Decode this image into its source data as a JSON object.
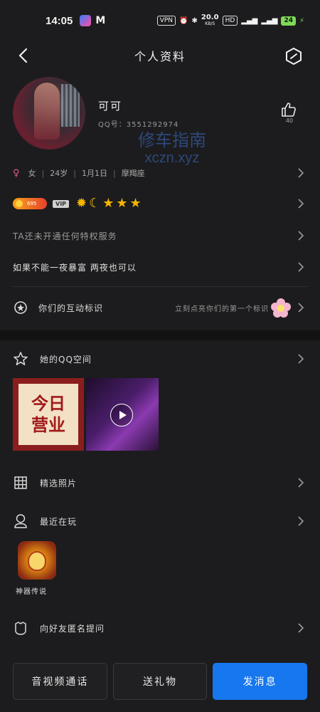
{
  "status_bar": {
    "time": "14:05",
    "vpn": "VPN",
    "net_speed": "20.0",
    "net_unit": "KB/S",
    "hd": "HD",
    "battery": "24"
  },
  "nav": {
    "title": "个人资料"
  },
  "profile": {
    "nickname": "可可",
    "qq_number": "QQ号：3551292974",
    "like_count": "40",
    "watermark_line1": "修车指南",
    "watermark_line2": "xczn.xyz"
  },
  "info": {
    "gender": "女",
    "age": "24岁",
    "birthday": "1月1日",
    "zodiac": "摩羯座"
  },
  "badges": {
    "level": "695",
    "vip": "VIP"
  },
  "vip_service": "TA还未开通任何特权服务",
  "signature": "如果不能一夜暴富 两夜也可以",
  "interaction": {
    "label": "你们的互动标识",
    "hint": "立刻点亮你们的第一个标识"
  },
  "sections": {
    "qzone": "她的QQ空间",
    "featured_photos": "精选照片",
    "recently_playing": "最近在玩",
    "anon_question": "向好友匿名提问"
  },
  "qzone_thumb": {
    "line1": "今日",
    "line2": "营业"
  },
  "game": {
    "name": "神器传说"
  },
  "actions": {
    "call": "音视频通话",
    "gift": "送礼物",
    "message": "发消息"
  }
}
